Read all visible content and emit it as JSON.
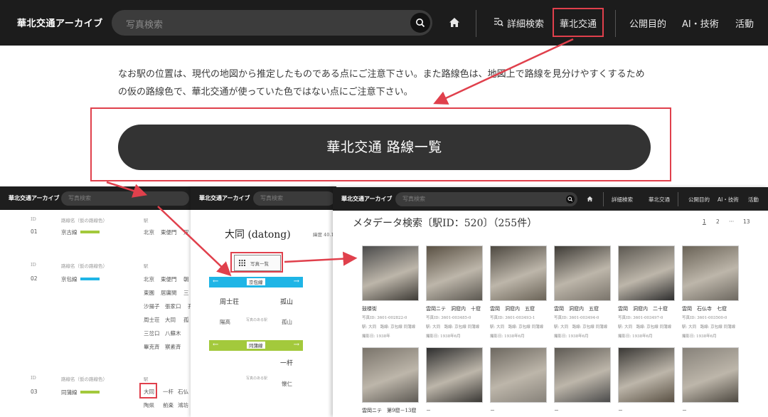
{
  "header": {
    "logo": "華北交通アーカイブ",
    "search_placeholder": "写真検索",
    "nav": {
      "advanced_search": "詳細検索",
      "north_china": "華北交通",
      "purpose": "公開目的",
      "ai_tech": "AI・技術",
      "activity": "活動"
    }
  },
  "notice": "なお駅の位置は、現代の地図から推定したものである点にご注意下さい。また路線色は、地図上で路線を見分けやすくするための仮の路線色で、華北交通が使っていた色ではない点にご注意下さい。",
  "route_list_button": "華北交通 路線一覧",
  "panel_routes": {
    "logo": "華北交通アーカイブ",
    "search_placeholder": "写真検索",
    "col_id": "ID",
    "col_route": "路線名（仮の路線色）",
    "col_station": "駅",
    "rows": [
      {
        "id": "01",
        "name": "京古線",
        "color": "#a3c93c",
        "stations": [
          "北京",
          "東便門",
          "双"
        ]
      },
      {
        "id": "02",
        "name": "京包線",
        "color": "#1fb5e6",
        "stations": [
          "北京",
          "東便門",
          "朝",
          "東園",
          "居庸関",
          "三",
          "沙揚子",
          "張家口",
          "孔",
          "周士荘",
          "大同",
          "孤",
          "三岔口",
          "八蘇木",
          "",
          "畢克斉",
          "察素斉",
          ""
        ]
      },
      {
        "id": "03",
        "name": "同蒲線",
        "color": "#a3c93c",
        "stations": [
          "大同",
          "一杆",
          "石仏",
          "陶県",
          "前楽",
          "鴻坊"
        ]
      }
    ]
  },
  "panel_station": {
    "logo": "華北交通アーカイブ",
    "search_placeholder": "写真検索",
    "station_name": "大同 (datong)",
    "latlng_label": "緯度 40.1",
    "photo_list_button": "写真一覧",
    "line1": {
      "name": "京包線",
      "color": "#1fb5e6",
      "prev": "周士荘",
      "next": "孤山",
      "prev2": "陽高",
      "note": "写真のある駅",
      "next2": "孤山"
    },
    "line2": {
      "name": "同蒲線",
      "color": "#a3c93c",
      "next": "一杆",
      "note": "写真のある駅",
      "next2": "懐仁"
    }
  },
  "panel_results": {
    "logo": "華北交通アーカイブ",
    "search_placeholder": "写真検索",
    "nav": {
      "advanced_search": "詳細検索",
      "north_china": "華北交通",
      "purpose": "公開目的",
      "ai_tech": "AI・技術",
      "activity": "活動"
    },
    "title": "メタデータ検索〔駅ID：520〕（255件）",
    "pagination": [
      "1",
      "2",
      "···",
      "13"
    ],
    "cards": [
      {
        "title": "鼓楼街",
        "meta1": "写真ID: 3601-002822-0",
        "meta2": "駅: 大同　路線: 京包線 同蒲線",
        "meta3": "撮影日: 1938年"
      },
      {
        "title": "雲岡ニテ　洞窟内　十窟",
        "meta1": "写真ID: 3601-003485-0",
        "meta2": "駅: 大同　路線: 京包線 同蒲線",
        "meta3": "撮影日: 1938年6月"
      },
      {
        "title": "雲岡　洞窟内　五窟",
        "meta1": "写真ID: 3601-003493-1",
        "meta2": "駅: 大同　路線: 京包線 同蒲線",
        "meta3": "撮影日: 1938年6月"
      },
      {
        "title": "雲岡　洞窟内　五窟",
        "meta1": "写真ID: 3601-003494-0",
        "meta2": "駅: 大同　路線: 京包線 同蒲線",
        "meta3": "撮影日: 1938年6月"
      },
      {
        "title": "雲岡　洞窟内　二十窟",
        "meta1": "写真ID: 3601-003497-0",
        "meta2": "駅: 大同　路線: 京包線 同蒲線",
        "meta3": "撮影日: 1938年6月"
      },
      {
        "title": "雲岡　石仏寺　七窟",
        "meta1": "写真ID: 3601-003500-0",
        "meta2": "駅: 大同　路線: 京包線 同蒲線",
        "meta3": "撮影日: 1938年6月"
      },
      {
        "title": "雲岡ニテ　第9窟－13窟",
        "meta1": "",
        "meta2": "",
        "meta3": ""
      },
      {
        "title": "－",
        "meta1": "",
        "meta2": "",
        "meta3": ""
      },
      {
        "title": "－",
        "meta1": "",
        "meta2": "",
        "meta3": ""
      },
      {
        "title": "－",
        "meta1": "",
        "meta2": "",
        "meta3": ""
      },
      {
        "title": "－",
        "meta1": "",
        "meta2": "",
        "meta3": ""
      },
      {
        "title": "－",
        "meta1": "",
        "meta2": "",
        "meta3": ""
      }
    ]
  },
  "colors": {
    "highlight": "#e0404c",
    "dark_bar": "#1c1c1c"
  }
}
